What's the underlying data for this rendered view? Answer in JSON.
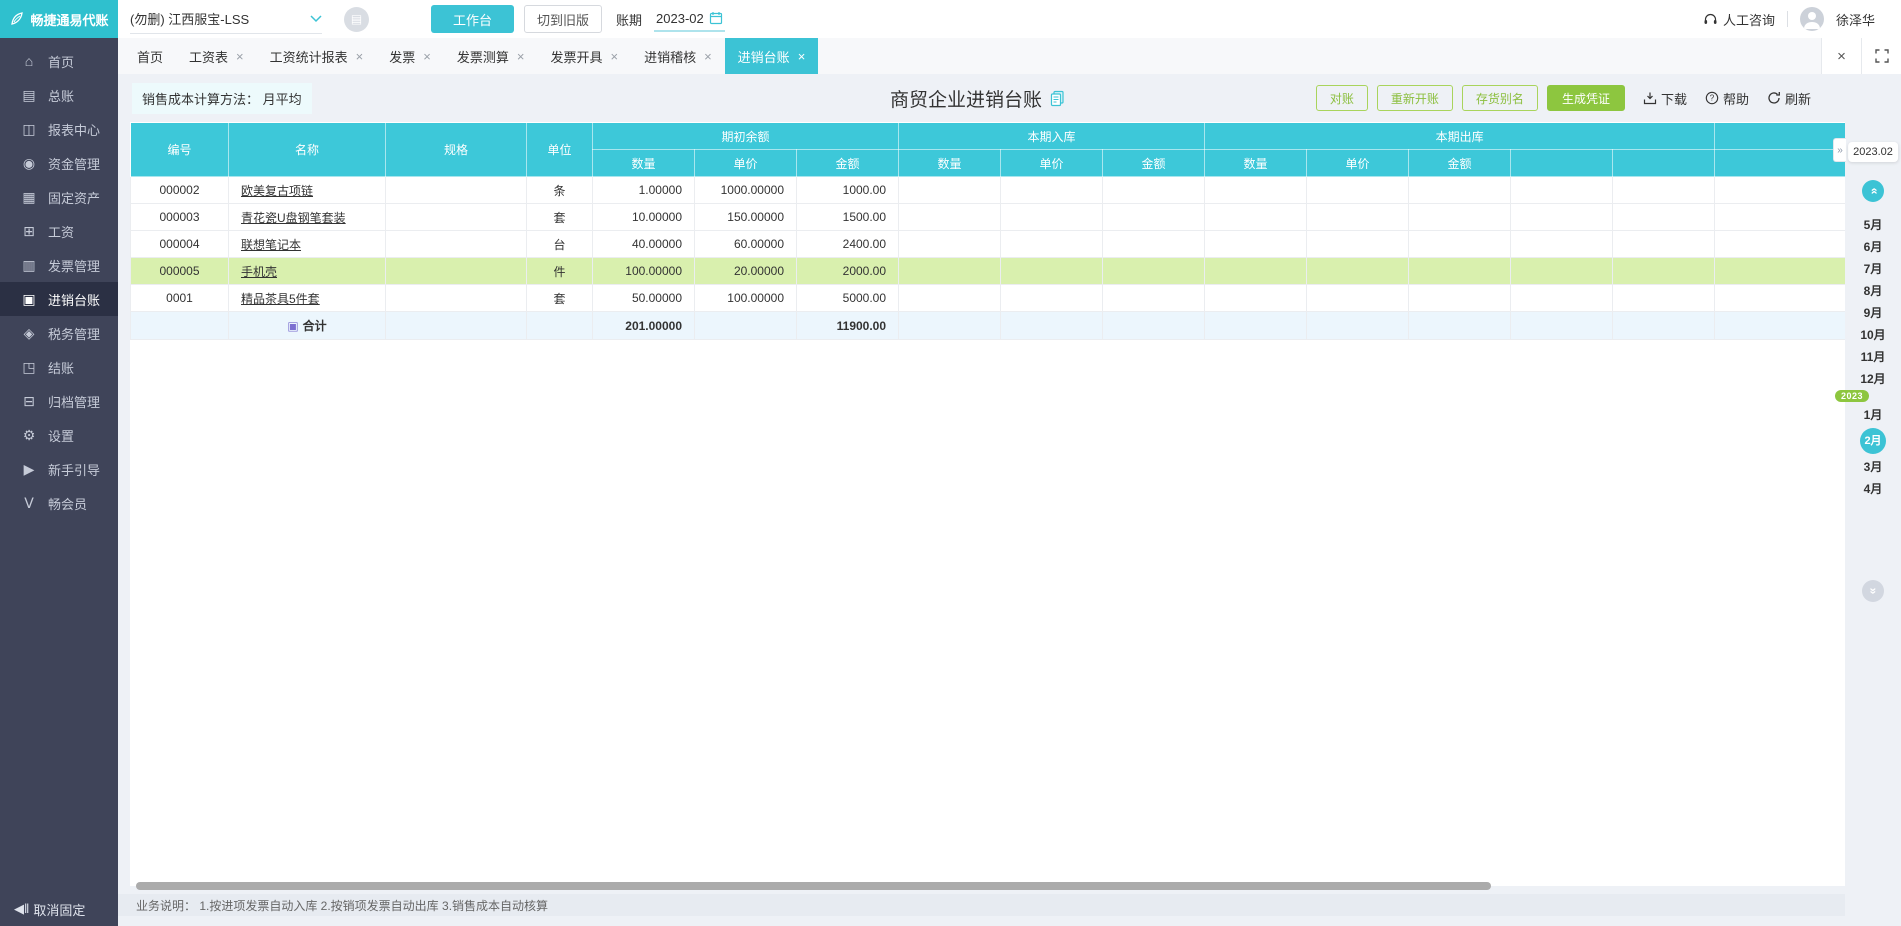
{
  "topbar": {
    "logo_text": "畅捷通易代账",
    "company_selector": "(勿删) 江西服宝-LSS",
    "workbench_button": "工作台",
    "switch_old_button": "切到旧版",
    "period_label": "账期",
    "period_value": "2023-02",
    "support_link": "人工咨询",
    "username": "徐泽华"
  },
  "sidebar": {
    "unpin_label": "取消固定",
    "items": [
      {
        "id": "home",
        "label": "首页",
        "icon": "home-icon",
        "glyph": "⌂",
        "active": false
      },
      {
        "id": "general-ledger",
        "label": "总账",
        "icon": "ledger-icon",
        "glyph": "▤",
        "active": false
      },
      {
        "id": "report-center",
        "label": "报表中心",
        "icon": "report-icon",
        "glyph": "◫",
        "active": false
      },
      {
        "id": "funds",
        "label": "资金管理",
        "icon": "funds-icon",
        "glyph": "◉",
        "active": false
      },
      {
        "id": "fixed-assets",
        "label": "固定资产",
        "icon": "fixed-assets-icon",
        "glyph": "▦",
        "active": false
      },
      {
        "id": "salary",
        "label": "工资",
        "icon": "salary-icon",
        "glyph": "⊞",
        "active": false
      },
      {
        "id": "invoice",
        "label": "发票管理",
        "icon": "invoice-icon",
        "glyph": "▥",
        "active": false
      },
      {
        "id": "purchase-sale-ledger",
        "label": "进销台账",
        "icon": "purchase-sale-icon",
        "glyph": "▣",
        "active": true
      },
      {
        "id": "tax",
        "label": "税务管理",
        "icon": "tax-icon",
        "glyph": "◈",
        "active": false
      },
      {
        "id": "closing",
        "label": "结账",
        "icon": "closing-icon",
        "glyph": "◳",
        "active": false
      },
      {
        "id": "archive",
        "label": "归档管理",
        "icon": "archive-icon",
        "glyph": "⊟",
        "active": false
      },
      {
        "id": "settings",
        "label": "设置",
        "icon": "gear-icon",
        "glyph": "⚙",
        "active": false
      },
      {
        "id": "beginner-guide",
        "label": "新手引导",
        "icon": "guide-icon",
        "glyph": "▶",
        "active": false
      },
      {
        "id": "member",
        "label": "畅会员",
        "icon": "member-icon",
        "glyph": "Ⅴ",
        "active": false
      }
    ]
  },
  "tabs": [
    {
      "label": "首页",
      "closable": false,
      "active": false
    },
    {
      "label": "工资表",
      "closable": true,
      "active": false
    },
    {
      "label": "工资统计报表",
      "closable": true,
      "active": false
    },
    {
      "label": "发票",
      "closable": true,
      "active": false
    },
    {
      "label": "发票测算",
      "closable": true,
      "active": false
    },
    {
      "label": "发票开具",
      "closable": true,
      "active": false
    },
    {
      "label": "进销稽核",
      "closable": true,
      "active": false
    },
    {
      "label": "进销台账",
      "closable": true,
      "active": true
    }
  ],
  "toolbar": {
    "cost_method_label": "销售成本计算方法：",
    "cost_method_value": "月平均",
    "page_title": "商贸企业进销台账",
    "outline_buttons": [
      "对账",
      "重新开账",
      "存货别名"
    ],
    "primary_button": "生成凭证",
    "download_label": "下载",
    "help_label": "帮助",
    "refresh_label": "刷新"
  },
  "table": {
    "fixed_columns": [
      "编号",
      "名称",
      "规格",
      "单位"
    ],
    "groups": [
      {
        "label": "期初余额",
        "cols": [
          "数量",
          "单价",
          "金额"
        ]
      },
      {
        "label": "本期入库",
        "cols": [
          "数量",
          "单价",
          "金额"
        ]
      },
      {
        "label": "本期出库",
        "cols": [
          "数量",
          "单价",
          "金额",
          "",
          ""
        ]
      },
      {
        "label": "",
        "cols": [
          ""
        ]
      }
    ],
    "rows": [
      {
        "code": "000002",
        "name": "欧美复古项链",
        "spec": "",
        "unit": "条",
        "opening_qty": "1.00000",
        "opening_price": "1000.00000",
        "opening_amount": "1000.00",
        "highlight": false
      },
      {
        "code": "000003",
        "name": "青花瓷U盘钢笔套装",
        "spec": "",
        "unit": "套",
        "opening_qty": "10.00000",
        "opening_price": "150.00000",
        "opening_amount": "1500.00",
        "highlight": false
      },
      {
        "code": "000004",
        "name": "联想笔记本",
        "spec": "",
        "unit": "台",
        "opening_qty": "40.00000",
        "opening_price": "60.00000",
        "opening_amount": "2400.00",
        "highlight": false
      },
      {
        "code": "000005",
        "name": "手机壳",
        "spec": "",
        "unit": "件",
        "opening_qty": "100.00000",
        "opening_price": "20.00000",
        "opening_amount": "2000.00",
        "highlight": true
      },
      {
        "code": "0001",
        "name": "精品茶具5件套",
        "spec": "",
        "unit": "套",
        "opening_qty": "50.00000",
        "opening_price": "100.00000",
        "opening_amount": "5000.00",
        "highlight": false
      }
    ],
    "total_row": {
      "label": "合计",
      "opening_qty": "201.00000",
      "opening_amount": "11900.00"
    }
  },
  "month_rail": {
    "current_period": "2023.02",
    "year_badge": "2023",
    "months_top": [
      "5月",
      "6月",
      "7月",
      "8月",
      "9月",
      "10月",
      "11月",
      "12月"
    ],
    "months_bottom": [
      {
        "label": "1月",
        "active": false
      },
      {
        "label": "2月",
        "active": true
      },
      {
        "label": "3月",
        "active": false
      },
      {
        "label": "4月",
        "active": false
      }
    ]
  },
  "footer": {
    "note": "业务说明：  1.按进项发票自动入库   2.按销项发票自动出库   3.销售成本自动核算"
  },
  "icons": {
    "close_glyph": "×",
    "collapse_glyph": "»",
    "scroll_glyph": "»",
    "unpin_glyph": "◀‖",
    "sum_glyph": "▣"
  },
  "colors": {
    "accent": "#3cc3d5",
    "table_header": "#3dc8d9",
    "green": "#8dc63f",
    "highlight_row": "#d9f0ae",
    "total_row_bg": "#ecf6fd",
    "sidebar_bg": "#3f4459"
  }
}
